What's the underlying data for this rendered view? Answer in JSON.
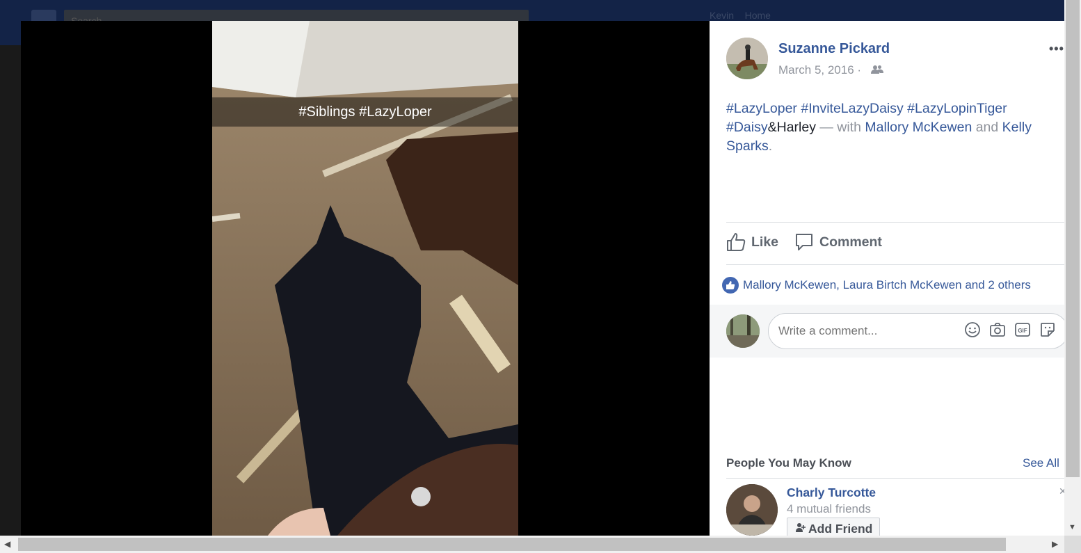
{
  "background": {
    "search_placeholder": "Search",
    "user_name": "Kevin",
    "home_label": "Home"
  },
  "photo": {
    "caption": "#Siblings #LazyLoper"
  },
  "post": {
    "author": "Suzanne Pickard",
    "date": "March 5, 2016 ·",
    "privacy_icon": "friends-icon",
    "hashtags": [
      "#LazyLoper",
      "#InviteLazyDaisy",
      "#LazyLopinTiger",
      "#Daisy"
    ],
    "text_plain": "&Harley",
    "with_text": " — with ",
    "tagged": [
      "Mallory McKewen",
      "Kelly Sparks"
    ],
    "and_text": " and ",
    "end_text": "."
  },
  "actions": {
    "like_label": "Like",
    "comment_label": "Comment"
  },
  "reactions": {
    "text": "Mallory McKewen, Laura Birtch McKewen and 2 others"
  },
  "comment_box": {
    "placeholder": "Write a comment..."
  },
  "pymk": {
    "title": "People You May Know",
    "see_all": "See All",
    "person": {
      "name": "Charly Turcotte",
      "mutual": "4 mutual friends",
      "add_label": "Add Friend"
    }
  },
  "colors": {
    "link": "#365899",
    "muted": "#90949c",
    "like_badge": "#4267b2"
  }
}
